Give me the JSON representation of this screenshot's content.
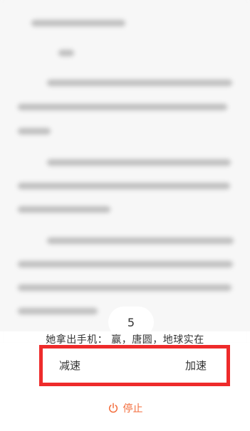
{
  "reader": {
    "sentence": "她拿出手机：  赢，唐圆，地球实在"
  },
  "speed_panel": {
    "speed_value": "5",
    "slower_label": "减速",
    "faster_label": "加速"
  },
  "actions": {
    "stop_label": "停止"
  },
  "theme": {
    "highlight": "#ee2b2b",
    "stop_accent": "#f36b3a"
  }
}
